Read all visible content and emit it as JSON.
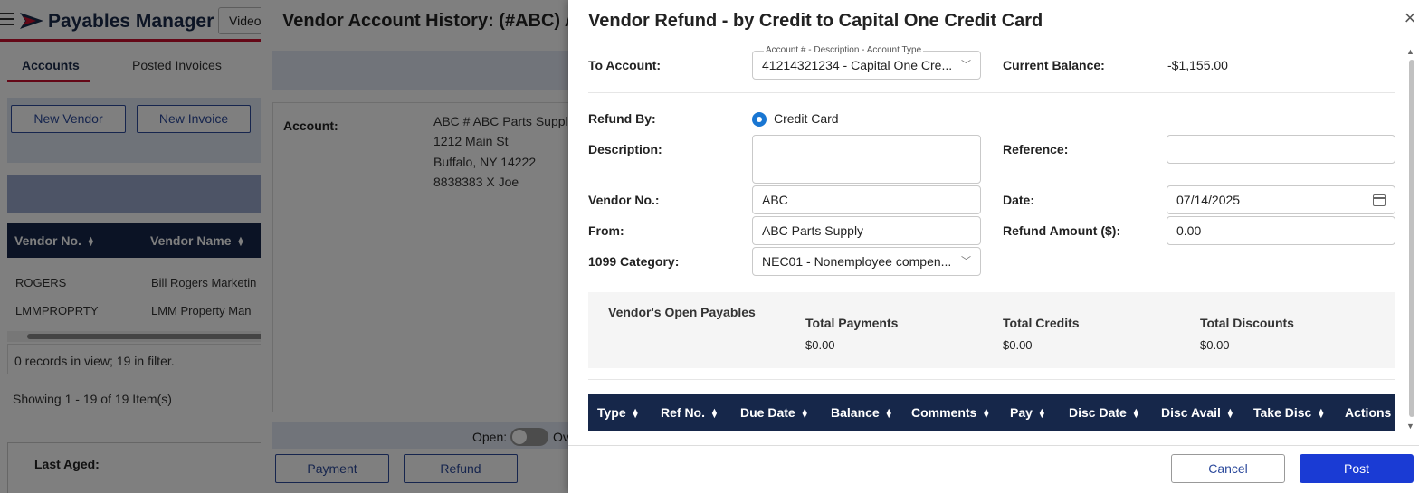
{
  "app": {
    "title": "Payables Manager",
    "video_label": "Video"
  },
  "bg": {
    "tabs": [
      "Accounts",
      "Posted Invoices"
    ],
    "buttons": [
      "New Vendor",
      "New Invoice"
    ],
    "grid_headers": [
      "Vendor No.",
      "Vendor Name"
    ],
    "rows": [
      {
        "vendor_no": "ROGERS",
        "vendor_name": "Bill Rogers Marketin"
      },
      {
        "vendor_no": "LMMPROPRTY",
        "vendor_name": "LMM Property Man"
      }
    ],
    "records_text": "0 records in view; 19 in filter.",
    "showing_text": "Showing 1 - 19 of 19 Item(s)",
    "last_aged": "Last Aged:"
  },
  "history": {
    "title": "Vendor Account History: (#ABC) A",
    "account_label": "Account:",
    "address": [
      "ABC # ABC Parts Supply",
      "1212 Main St",
      "Buffalo, NY 14222",
      "8838383 X Joe"
    ],
    "open_label": "Open:",
    "ov_label": "Ov",
    "payment_label": "Payment",
    "refund_label": "Refund"
  },
  "dialog": {
    "title": "Vendor Refund - by Credit to Capital One Credit Card",
    "to_account_label": "To Account:",
    "account_legend": "Account # - Description - Account Type",
    "account_value": "41214321234 - Capital One Cre...",
    "current_balance_label": "Current Balance:",
    "current_balance": "-$1,155.00",
    "refund_by_label": "Refund By:",
    "refund_by_option": "Credit Card",
    "description_label": "Description:",
    "description_value": "",
    "reference_label": "Reference:",
    "reference_value": "",
    "vendor_no_label": "Vendor No.:",
    "vendor_no_value": "ABC",
    "date_label": "Date:",
    "date_value": "07/14/2025",
    "from_label": "From:",
    "from_value": "ABC Parts Supply",
    "refund_amount_label": "Refund Amount ($):",
    "refund_amount_value": "0.00",
    "category_label": "1099 Category:",
    "category_value": "NEC01 - Nonemployee compen...",
    "payables": {
      "title": "Vendor's Open Payables",
      "total_payments_label": "Total Payments",
      "total_payments": "$0.00",
      "total_credits_label": "Total Credits",
      "total_credits": "$0.00",
      "total_discounts_label": "Total Discounts",
      "total_discounts": "$0.00"
    },
    "columns": [
      "Type",
      "Ref No.",
      "Due Date",
      "Balance",
      "Comments",
      "Pay",
      "Disc Date",
      "Disc Avail",
      "Take Disc",
      "Actions"
    ],
    "cancel_label": "Cancel",
    "post_label": "Post"
  },
  "colors": {
    "navy": "#16274a",
    "accent_red": "#c8102e",
    "primary_blue": "#1a3bd4"
  }
}
